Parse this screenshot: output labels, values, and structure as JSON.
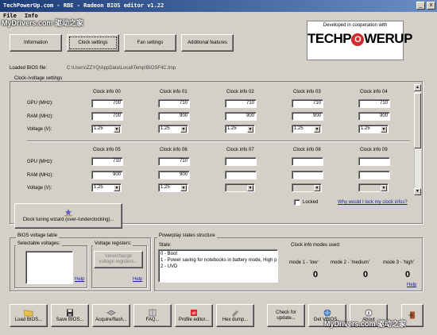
{
  "window": {
    "title": "TechPowerUp.com - RBE - Radeon BIOS editor v1.22",
    "minimize": "_",
    "close": "x"
  },
  "menu": [
    "File",
    "Info"
  ],
  "watermark_top": "MyDrivers.com 驱动之家",
  "watermark_bottom": "MyDrivers.com 驱动之家",
  "tabs": {
    "information": "Information",
    "clock_settings": "Clock settings",
    "fan_settings": "Fan settings",
    "additional_features": "Additional features"
  },
  "logo": {
    "caption": "Developed in cooperation with",
    "text_left": "TECHP",
    "text_o": "O",
    "text_right": "WERUP"
  },
  "bios_file": {
    "label": "Loaded BIOS file:",
    "path": "C:\\Users\\ZZYQ\\AppData\\Local\\Temp\\BIOSF4C.tmp"
  },
  "clock_group": {
    "title": "Clock-/voltage settings",
    "row_labels": [
      "GPU (MHz):",
      "RAM (MHz):",
      "Voltage (V):"
    ],
    "top": [
      {
        "header": "Clock info 00",
        "gpu": "700",
        "ram": "700",
        "volt": "1.25"
      },
      {
        "header": "Clock info 01",
        "gpu": "710",
        "ram": "900",
        "volt": "1.25"
      },
      {
        "header": "Clock info 02",
        "gpu": "710",
        "ram": "900",
        "volt": "1.25"
      },
      {
        "header": "Clock info 03",
        "gpu": "710",
        "ram": "900",
        "volt": "1.25"
      },
      {
        "header": "Clock info 04",
        "gpu": "710",
        "ram": "900",
        "volt": "1.25"
      }
    ],
    "bottom": [
      {
        "header": "Clock info 05",
        "gpu": "710",
        "ram": "900",
        "volt": "1.25"
      },
      {
        "header": "Clock info 06",
        "gpu": "710",
        "ram": "900",
        "volt": "1.25"
      },
      {
        "header": "Clock info 07",
        "gpu": "",
        "ram": "",
        "volt": ""
      },
      {
        "header": "Clock info 08",
        "gpu": "",
        "ram": "",
        "volt": ""
      },
      {
        "header": "Clock info 09",
        "gpu": "",
        "ram": "",
        "volt": ""
      }
    ],
    "wizard_button": "Clock tuning wizard (over-/underclocking)...",
    "locked_label": "Locked",
    "why_link": "Why would I lock my clock infos?"
  },
  "voltage_table": {
    "title": "BIOS voltage table",
    "selectable_title": "Selectable voltages:",
    "registers_title": "Voltage registers:",
    "view_change_button": "View/change\nvoltage registers...",
    "help": "Help"
  },
  "powerplay": {
    "title": "Powerplay states structure",
    "state_label": "State:",
    "states": [
      "0 - Boot",
      "1 - Power saving for notebooks in battery mode, High p",
      "2 - UVD"
    ],
    "modes_title": "Clock info modes used:",
    "modes": [
      {
        "label": "mode 1 - 'low'",
        "value": "0"
      },
      {
        "label": "mode 2 - 'medium'",
        "value": "0"
      },
      {
        "label": "mode 3 - 'high'",
        "value": "0"
      }
    ],
    "help": "Help"
  },
  "toolbar": [
    {
      "label": "Load BIOS...",
      "icon": "folder-icon"
    },
    {
      "label": "Save BIOS...",
      "icon": "floppy-icon"
    },
    {
      "label": "Acquire/flash...",
      "icon": "chip-icon"
    },
    {
      "label": "FAQ...",
      "icon": "book-icon"
    },
    {
      "label": "Profile editor...",
      "icon": "profile-icon"
    },
    {
      "label": "Hex dump...",
      "icon": "hex-icon"
    },
    {
      "label": "Check for\nupdate...",
      "icon": ""
    },
    {
      "label": "Get VBIOS...",
      "icon": "globe-icon"
    },
    {
      "label": "About",
      "icon": "info-icon"
    },
    {
      "label": "",
      "icon": "exit-icon"
    }
  ],
  "colors": {
    "window_bg": "#d4d0c8",
    "title_start": "#1c3c78",
    "title_end": "#6a8ec4",
    "logo_red": "#d22b2b",
    "link": "#1a1aa6"
  }
}
